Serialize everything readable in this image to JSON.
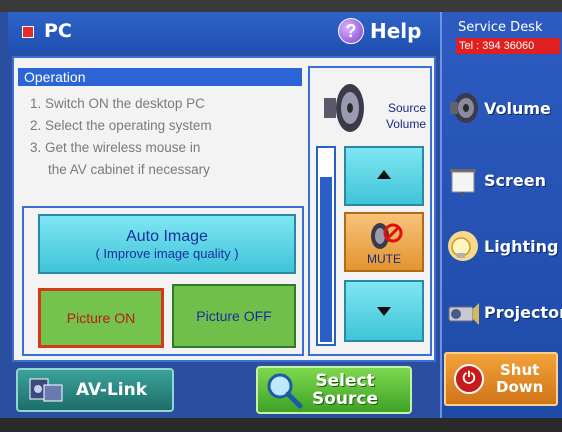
{
  "header": {
    "title": "PC",
    "help_label": "Help"
  },
  "service_desk": {
    "title": "Service Desk",
    "tel": "Tel : 394 36060"
  },
  "operation": {
    "title": "Operation",
    "steps": [
      "1. Switch ON the desktop PC",
      "2. Select the operating system",
      "3. Get the wireless mouse in",
      "the AV cabinet if necessary"
    ]
  },
  "controls": {
    "auto_image_line1": "Auto Image",
    "auto_image_line2": "( Improve image quality )",
    "picture_on": "Picture ON",
    "picture_off": "Picture OFF",
    "source_volume_line1": "Source",
    "source_volume_line2": "Volume",
    "mute": "MUTE",
    "volume_level_percent": 86
  },
  "side_menu": [
    {
      "label": "Volume",
      "icon": "speaker-icon"
    },
    {
      "label": "Screen",
      "icon": "projection-screen-icon"
    },
    {
      "label": "Lighting",
      "icon": "lightbulb-icon"
    },
    {
      "label": "Projector",
      "icon": "projector-icon"
    }
  ],
  "shut_down": {
    "line1": "Shut",
    "line2": "Down"
  },
  "bottom": {
    "av_link": "AV-Link",
    "select_source_line1": "Select",
    "select_source_line2": "Source"
  },
  "colors": {
    "background": "#2b4fa0",
    "accent_red": "#e52a2a",
    "button_cyan": "#3fc4d8",
    "button_green": "#6fbf4a",
    "shutdown_orange": "#e38a2a"
  }
}
